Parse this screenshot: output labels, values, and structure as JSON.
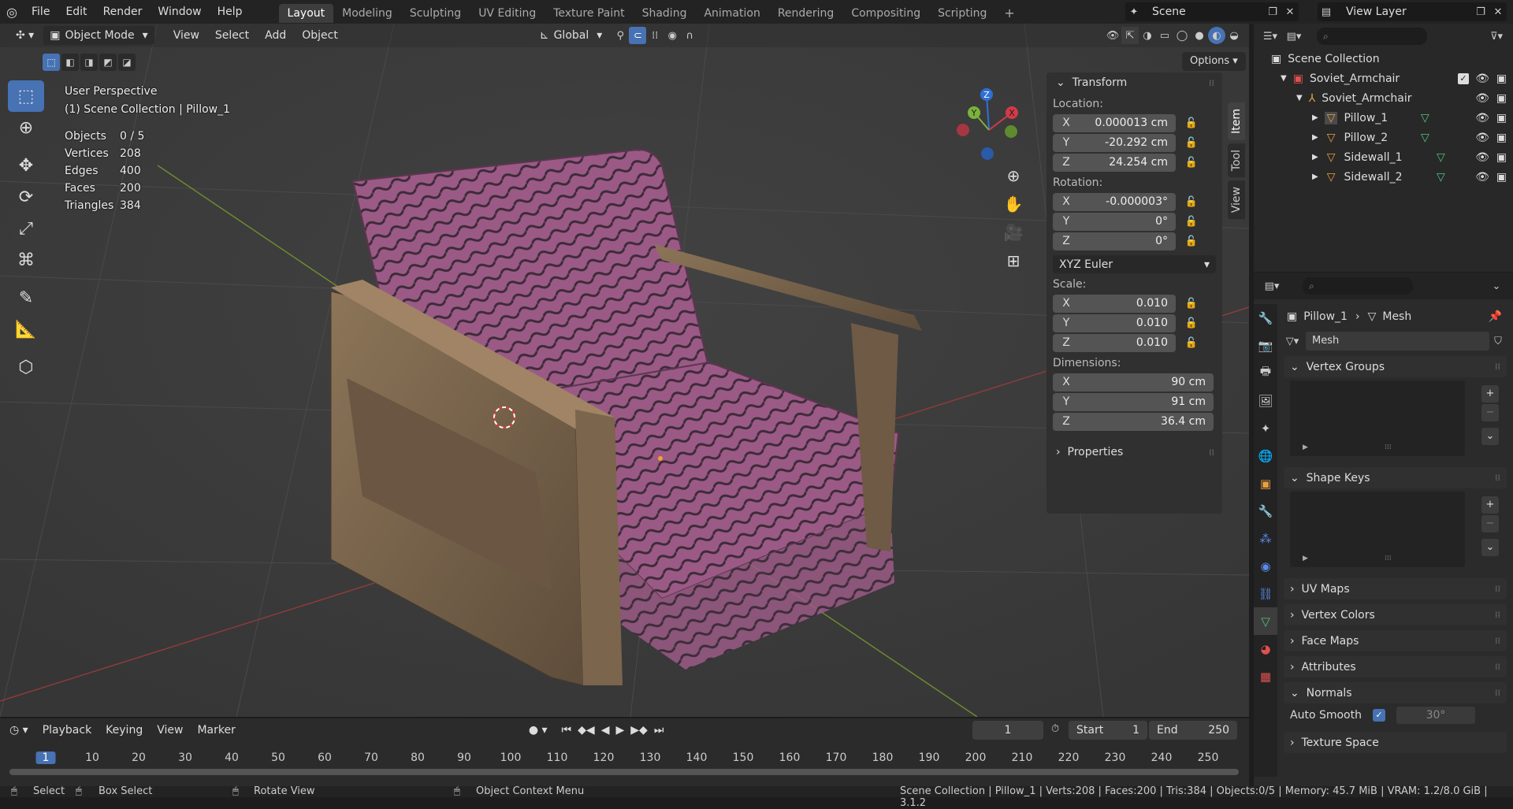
{
  "top_menu": [
    "File",
    "Edit",
    "Render",
    "Window",
    "Help"
  ],
  "workspaces": [
    "Layout",
    "Modeling",
    "Sculpting",
    "UV Editing",
    "Texture Paint",
    "Shading",
    "Animation",
    "Rendering",
    "Compositing",
    "Scripting"
  ],
  "active_workspace": "Layout",
  "scene": {
    "label": "Scene"
  },
  "view_layer": {
    "label": "View Layer"
  },
  "viewport": {
    "mode": "Object Mode",
    "menus": [
      "View",
      "Select",
      "Add",
      "Object"
    ],
    "orientation": "Global",
    "options": "Options",
    "perspective": "User Perspective",
    "collection_path": "(1) Scene Collection | Pillow_1",
    "stats": [
      {
        "k": "Objects",
        "v": "0 / 5"
      },
      {
        "k": "Vertices",
        "v": "208"
      },
      {
        "k": "Edges",
        "v": "400"
      },
      {
        "k": "Faces",
        "v": "200"
      },
      {
        "k": "Triangles",
        "v": "384"
      }
    ],
    "gizmo": {
      "z": "Z",
      "y": "Y",
      "x": "X"
    }
  },
  "npanel": {
    "transform": "Transform",
    "location_label": "Location:",
    "location": [
      {
        "ax": "X",
        "v": "0.000013 cm"
      },
      {
        "ax": "Y",
        "v": "-20.292 cm"
      },
      {
        "ax": "Z",
        "v": "24.254 cm"
      }
    ],
    "rotation_label": "Rotation:",
    "rotation": [
      {
        "ax": "X",
        "v": "-0.000003°"
      },
      {
        "ax": "Y",
        "v": "0°"
      },
      {
        "ax": "Z",
        "v": "0°"
      }
    ],
    "rotation_mode": "XYZ Euler",
    "scale_label": "Scale:",
    "scale": [
      {
        "ax": "X",
        "v": "0.010"
      },
      {
        "ax": "Y",
        "v": "0.010"
      },
      {
        "ax": "Z",
        "v": "0.010"
      }
    ],
    "dimensions_label": "Dimensions:",
    "dimensions": [
      {
        "ax": "X",
        "v": "90 cm"
      },
      {
        "ax": "Y",
        "v": "91 cm"
      },
      {
        "ax": "Z",
        "v": "36.4 cm"
      }
    ],
    "properties": "Properties",
    "tabs": [
      "Item",
      "Tool",
      "View"
    ]
  },
  "timeline": {
    "menus": [
      "Playback",
      "Keying",
      "View",
      "Marker"
    ],
    "current_frame": "1",
    "start_label": "Start",
    "start": "1",
    "end_label": "End",
    "end": "250",
    "ticks": [
      "1",
      "10",
      "20",
      "30",
      "40",
      "50",
      "60",
      "70",
      "80",
      "90",
      "100",
      "110",
      "120",
      "130",
      "140",
      "150",
      "160",
      "170",
      "180",
      "190",
      "200",
      "210",
      "220",
      "230",
      "240",
      "250"
    ]
  },
  "statusbar": {
    "select": "Select",
    "box_select": "Box Select",
    "rotate_view": "Rotate View",
    "context_menu": "Object Context Menu",
    "info": "Scene Collection | Pillow_1 | Verts:208 | Faces:200 | Tris:384 | Objects:0/5 | Memory: 45.7 MiB | VRAM: 1.2/8.0 GiB | 3.1.2"
  },
  "outliner": {
    "root": "Scene Collection",
    "collection": "Soviet_Armchair",
    "empty": "Soviet_Armchair",
    "objects": [
      "Pillow_1",
      "Pillow_2",
      "Sidewall_1",
      "Sidewall_2"
    ]
  },
  "properties": {
    "object": "Pillow_1",
    "data": "Mesh",
    "mesh_name": "Mesh",
    "sections": {
      "vertex_groups": "Vertex Groups",
      "shape_keys": "Shape Keys",
      "uv_maps": "UV Maps",
      "vertex_colors": "Vertex Colors",
      "face_maps": "Face Maps",
      "attributes": "Attributes",
      "normals": "Normals",
      "texture_space": "Texture Space"
    },
    "auto_smooth_label": "Auto Smooth",
    "auto_smooth_angle": "30°"
  }
}
